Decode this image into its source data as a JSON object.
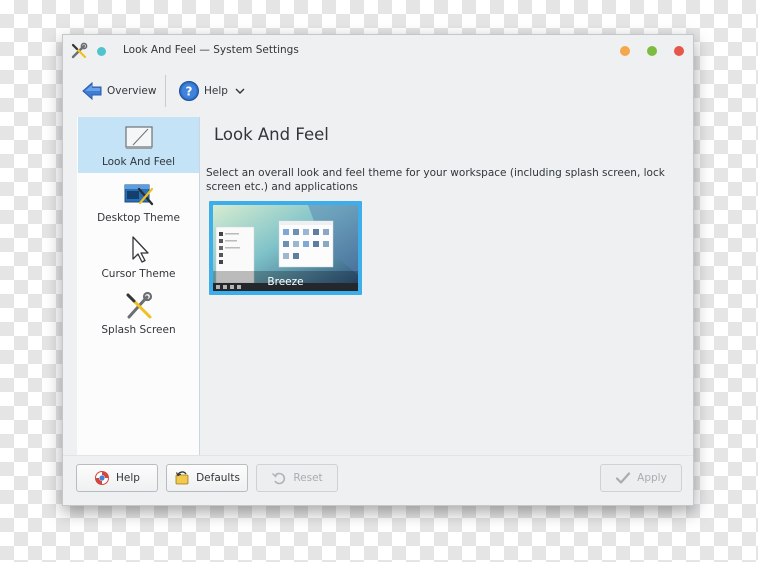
{
  "window": {
    "title": "Look And Feel  — System Settings",
    "accent_color": "#3daee9"
  },
  "toolbar": {
    "overview_label": "Overview",
    "overview_icon": "arrow-left-icon",
    "help_label": "Help",
    "help_icon": "help-icon"
  },
  "sidebar": {
    "items": [
      {
        "label": "Look And Feel",
        "icon": "look-and-feel-icon",
        "selected": true
      },
      {
        "label": "Desktop Theme",
        "icon": "desktop-theme-icon",
        "selected": false
      },
      {
        "label": "Cursor Theme",
        "icon": "cursor-icon",
        "selected": false
      },
      {
        "label": "Splash Screen",
        "icon": "splash-screen-icon",
        "selected": false
      }
    ]
  },
  "main": {
    "title": "Look And Feel",
    "description": "Select an overall look and feel theme for your workspace (including splash screen, lock screen etc.) and applications",
    "themes": [
      {
        "name": "Breeze",
        "selected": true
      }
    ]
  },
  "footer": {
    "help_label": "Help",
    "defaults_label": "Defaults",
    "reset_label": "Reset",
    "apply_label": "Apply"
  }
}
